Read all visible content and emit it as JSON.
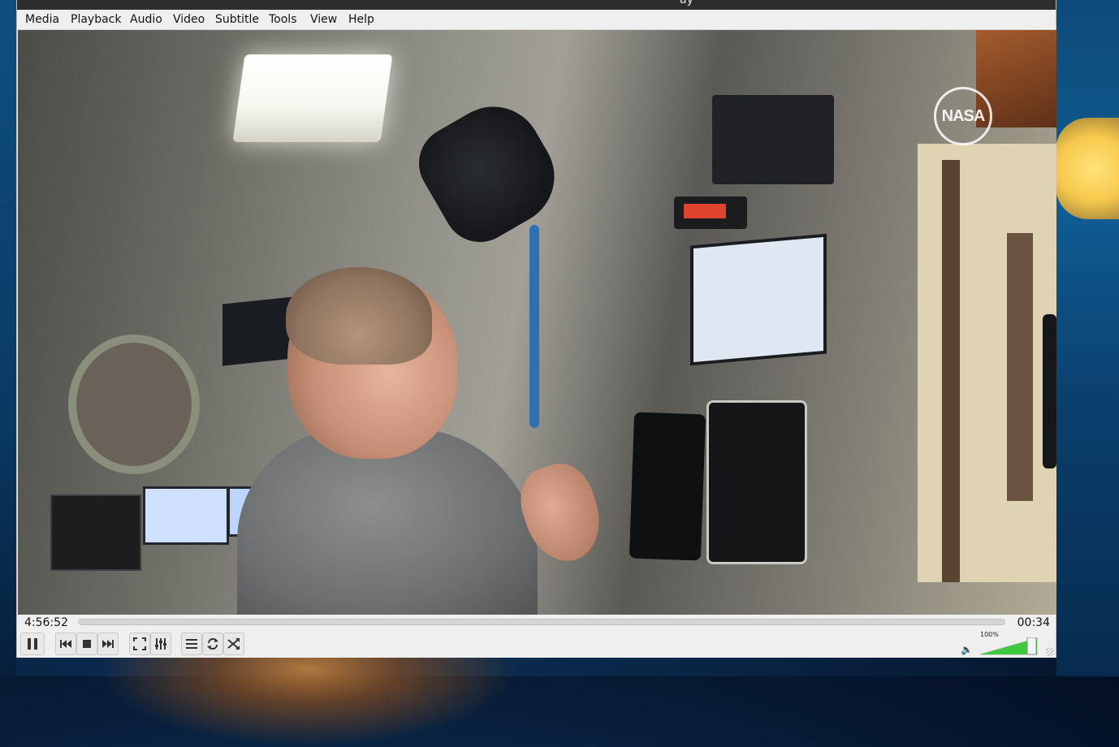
{
  "window": {
    "title_fragment": "ay"
  },
  "menu": {
    "items": [
      "Media",
      "Playback",
      "Audio",
      "Video",
      "Subtitle",
      "Tools",
      "View",
      "Help"
    ]
  },
  "video": {
    "watermark": "NASA"
  },
  "playback": {
    "elapsed": "4:56:52",
    "total": "00:34",
    "progress": 0.0
  },
  "controls": {
    "buttons": [
      "pause",
      "previous",
      "stop",
      "next",
      "fullscreen",
      "extended-settings",
      "playlist",
      "loop",
      "shuffle"
    ]
  },
  "volume": {
    "label": "100%",
    "level": 1.0
  },
  "colors": {
    "window_bg": "#efefef",
    "titlebar": "#2d2d2d",
    "volume_green": "#3ec93e"
  },
  "icons": {
    "pause": "pause-icon",
    "previous": "skip-previous-icon",
    "stop": "stop-icon",
    "next": "skip-next-icon",
    "fullscreen": "fullscreen-icon",
    "extended": "equalizer-icon",
    "playlist": "playlist-icon",
    "loop": "loop-icon",
    "shuffle": "shuffle-icon",
    "volume": "speaker-icon"
  }
}
